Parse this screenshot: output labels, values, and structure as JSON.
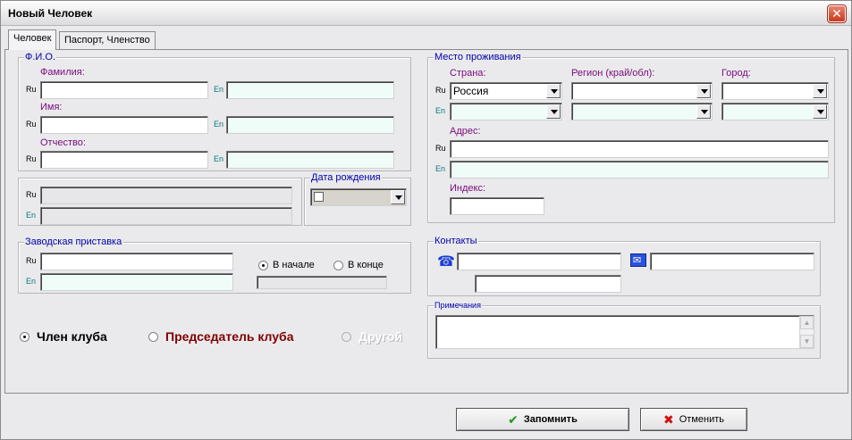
{
  "window": {
    "title": "Новый Человек",
    "close": "✕"
  },
  "tabs": [
    "Человек",
    "Паспорт, Членство"
  ],
  "fio": {
    "title": "Ф.И.О.",
    "surname_label": "Фамилия:",
    "name_label": "Имя:",
    "patronymic_label": "Отчество:",
    "ru": "Ru",
    "en": "En"
  },
  "birth": {
    "title": "Дата рождения"
  },
  "residence": {
    "title": "Место проживания",
    "country_label": "Страна:",
    "country_value": "Россия",
    "region_label": "Регион (край/обл):",
    "city_label": "Город:",
    "address_label": "Адрес:",
    "index_label": "Индекс:"
  },
  "factory": {
    "title": "Заводская приставка",
    "at_start": "В начале",
    "at_end": "В конце"
  },
  "contacts": {
    "title": "Контакты",
    "phone_icon": "phone-icon",
    "email_icon": "email-icon"
  },
  "notes": {
    "title": "Примечания"
  },
  "roles": {
    "member": "Член клуба",
    "chairman": "Председатель клуба",
    "other": "Другой"
  },
  "colors": {
    "chairman": "#800000",
    "label": "#7a0a7a",
    "group_title": "#0000a8"
  },
  "buttons": {
    "save": "Запомнить",
    "cancel": "Отменить"
  }
}
